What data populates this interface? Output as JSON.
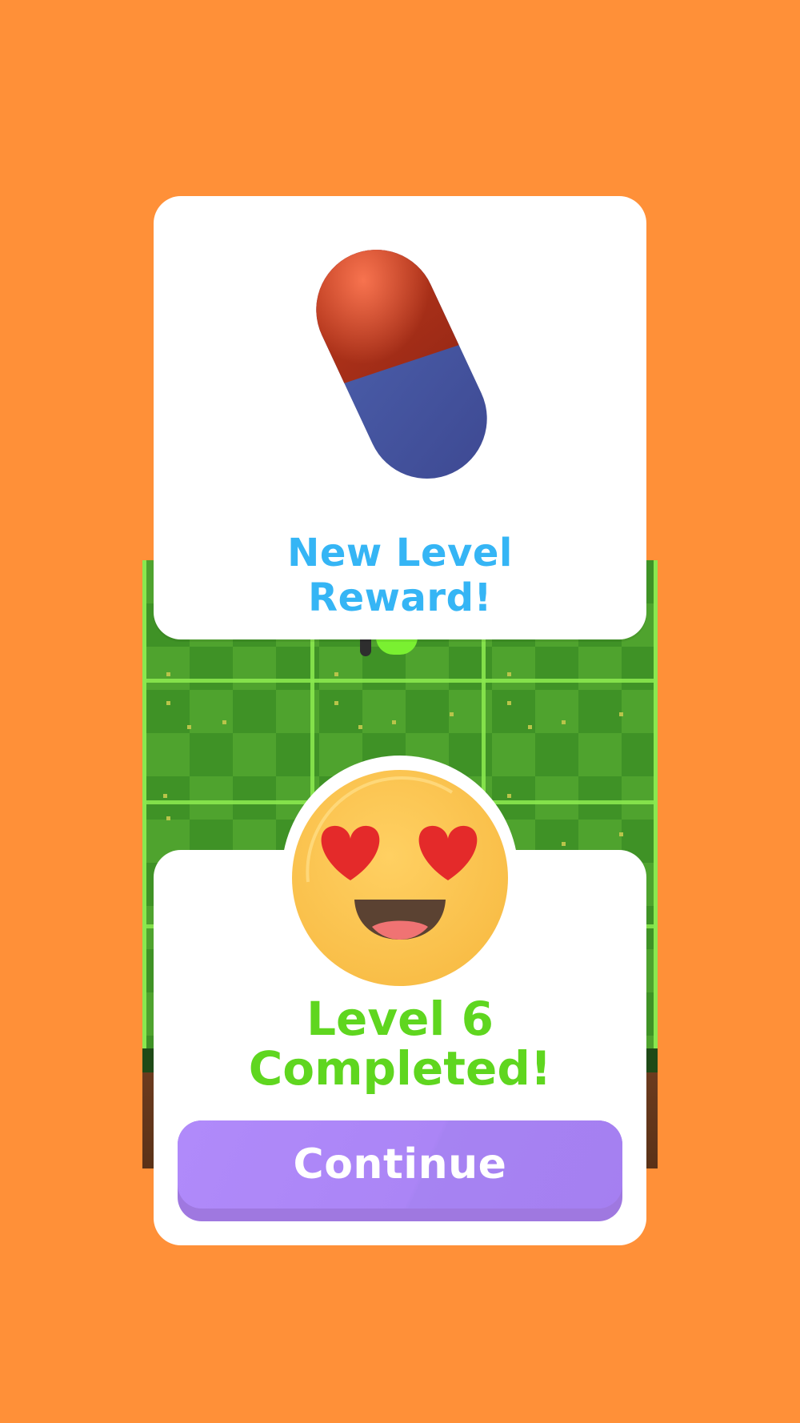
{
  "colors": {
    "background": "#FF9038",
    "reward_text": "#35B5F5",
    "complete_text": "#5FD61F",
    "button": "#AB85F6",
    "card": "#FFFFFF"
  },
  "reward": {
    "title_line1": "New Level",
    "title_line2": "Reward!",
    "item_icon": "capsule-pill-icon"
  },
  "completion": {
    "emoji_icon": "heart-eyes-emoji-icon",
    "title_line1": "Level 6",
    "title_line2": "Completed!",
    "level": 6
  },
  "actions": {
    "continue_label": "Continue"
  }
}
